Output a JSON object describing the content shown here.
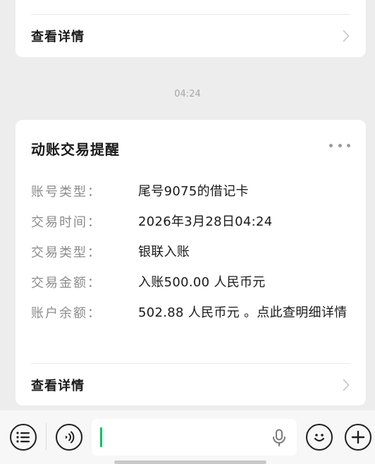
{
  "previous_card": {
    "view_details_label": "查看详情"
  },
  "timestamp": "04:24",
  "notification": {
    "title": "动账交易提醒",
    "fields": [
      {
        "label": "账号类型：",
        "value": "尾号9075的借记卡"
      },
      {
        "label": "交易时间：",
        "value": "2026年3月28日04:24"
      },
      {
        "label": "交易类型：",
        "value": "银联入账"
      },
      {
        "label": "交易金额：",
        "value": "入账500.00 人民币元"
      },
      {
        "label": "账户余额：",
        "value": "502.88 人民币元 。点此查明细详情"
      }
    ],
    "view_details_label": "查看详情"
  },
  "bottom_bar": {
    "icons": [
      "menu-list-icon",
      "voice-icon",
      "microphone-icon",
      "emoji-icon",
      "plus-icon"
    ],
    "input_value": "",
    "cursor_color": "#07c160"
  }
}
